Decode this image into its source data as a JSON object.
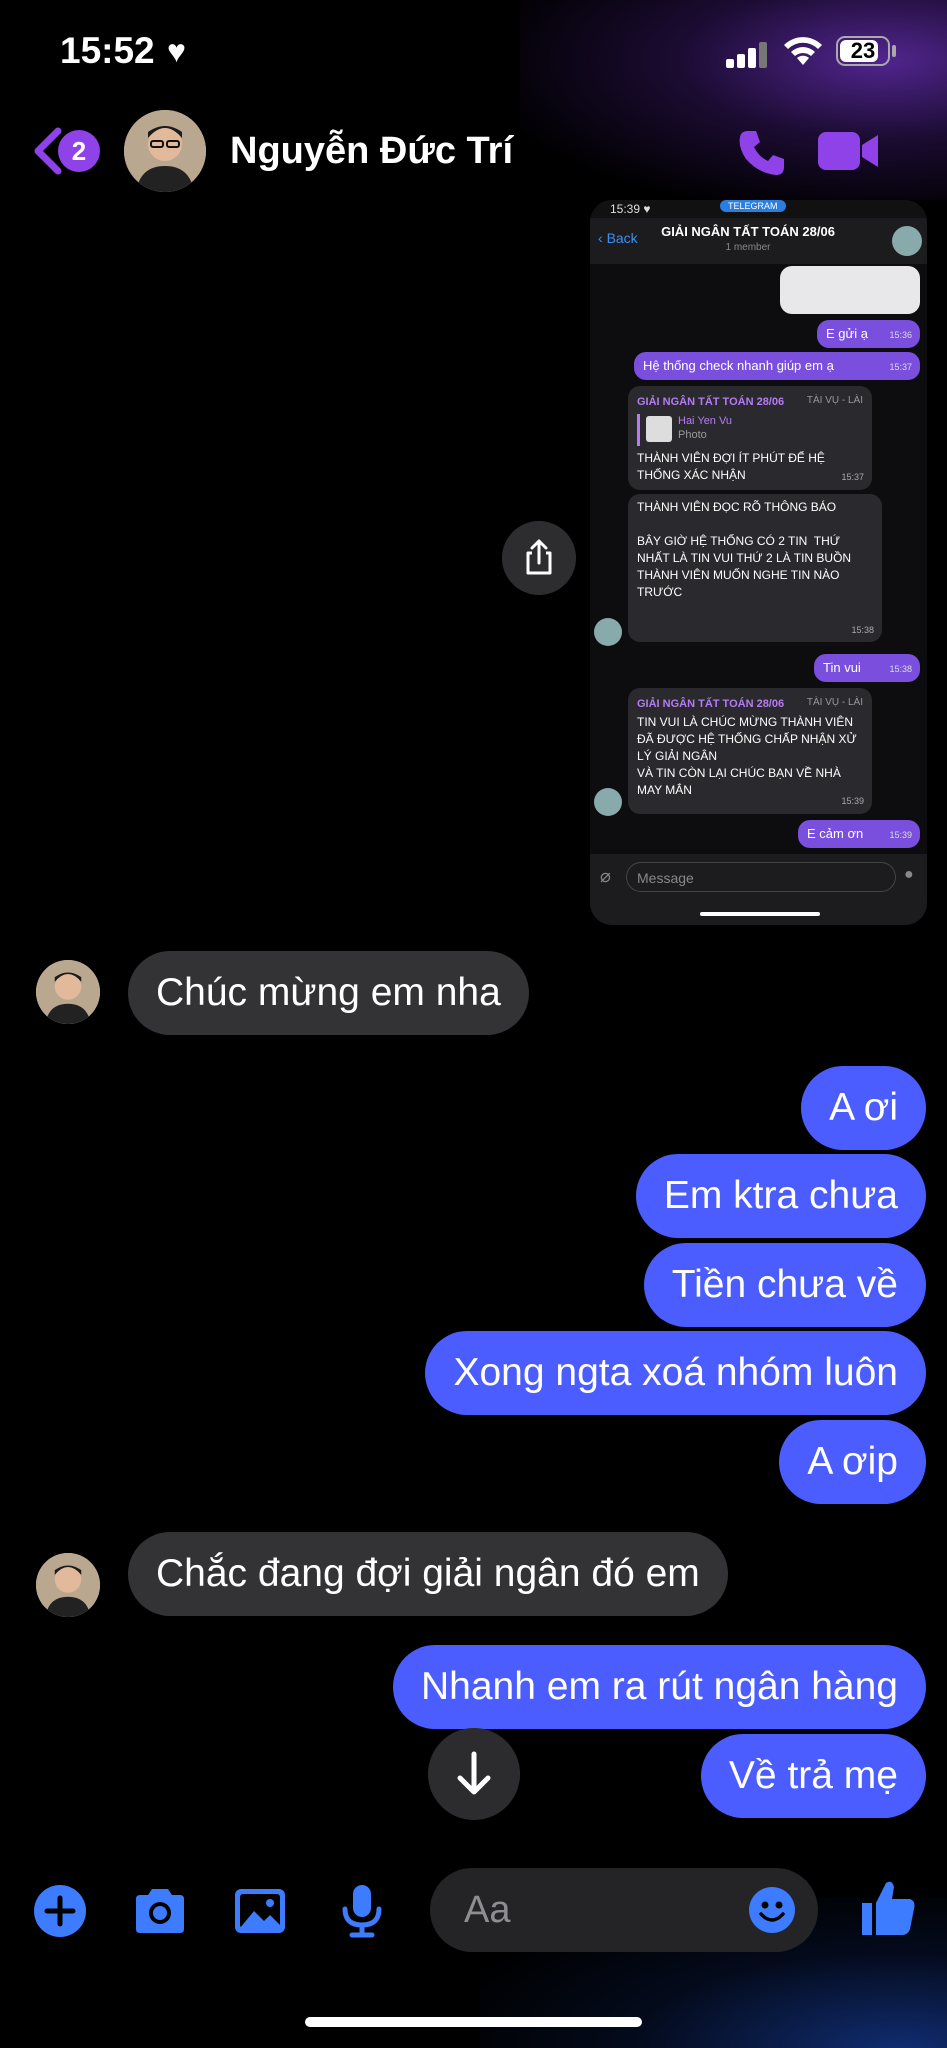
{
  "status_bar": {
    "time": "15:52",
    "heart": "♥",
    "battery": "23"
  },
  "header": {
    "back_badge": "2",
    "contact_name": "Nguyễn Đức Trí"
  },
  "screenshot": {
    "status_time": "15:39 ♥",
    "app_pill": "TELEGRAM",
    "back_label": "Back",
    "group_title": "GIẢI NGÂN TẤT TOÁN 28/06",
    "group_subtitle": "1 member",
    "messages": [
      {
        "dir": "out",
        "text": "E gửi ạ",
        "time": "15:36"
      },
      {
        "dir": "out",
        "text": "Hệ thống check nhanh giúp em ạ",
        "time": "15:37"
      },
      {
        "dir": "in",
        "sender": "GIẢI NGÂN TẤT TOÁN 28/06",
        "sender_tag": "TÀI VỤ - LÀI",
        "reply_name": "Hai Yen Vu",
        "reply_type": "Photo",
        "text": "THÀNH VIÊN ĐỢI ÍT PHÚT ĐỂ HỆ THỐNG XÁC NHẬN",
        "time": "15:37"
      },
      {
        "dir": "in",
        "text": "THÀNH VIÊN ĐỌC RÕ THÔNG BÁO\n\nBÂY GIỜ HỆ THỐNG CÓ 2 TIN  THỨ NHẤT LÀ TIN VUI THỨ 2 LÀ TIN BUỒN\nTHÀNH VIÊN MUỐN NGHE TIN NÀO TRƯỚC",
        "time": "15:38"
      },
      {
        "dir": "out",
        "text": "Tin vui",
        "time": "15:38"
      },
      {
        "dir": "in",
        "sender": "GIẢI NGÂN TẤT TOÁN 28/06",
        "sender_tag": "TÀI VỤ - LÀI",
        "text": "TIN VUI LÀ CHÚC MỪNG THÀNH VIÊN ĐÃ ĐƯỢC HỆ THỐNG CHẤP NHẬN XỬ LÝ GIẢI NGÂN\nVÀ TIN CÒN LẠI CHÚC BẠN VỀ NHÀ MAY MẮN",
        "time": "15:39"
      },
      {
        "dir": "out",
        "text": "E cảm ơn",
        "time": "15:39"
      }
    ],
    "input_placeholder": "Message"
  },
  "messages": [
    {
      "dir": "in",
      "text": "Chúc mừng em nha"
    },
    {
      "dir": "out",
      "text": "A ơi"
    },
    {
      "dir": "out",
      "text": "Em ktra chưa"
    },
    {
      "dir": "out",
      "text": "Tiền chưa về"
    },
    {
      "dir": "out",
      "text": "Xong ngta xoá nhóm luôn"
    },
    {
      "dir": "out",
      "text": "A ơip"
    },
    {
      "dir": "in",
      "text": "Chắc đang đợi giải ngân đó em"
    },
    {
      "dir": "out",
      "text": "Nhanh em ra rút ngân hàng"
    },
    {
      "dir": "out",
      "text": "Về trả mẹ"
    }
  ],
  "composer": {
    "placeholder": "Aa"
  },
  "colors": {
    "accent": "#8e42e8",
    "outgoing_bubble": "#4b5dff",
    "incoming_bubble": "#333336",
    "composer_icon": "#3d7bff"
  }
}
